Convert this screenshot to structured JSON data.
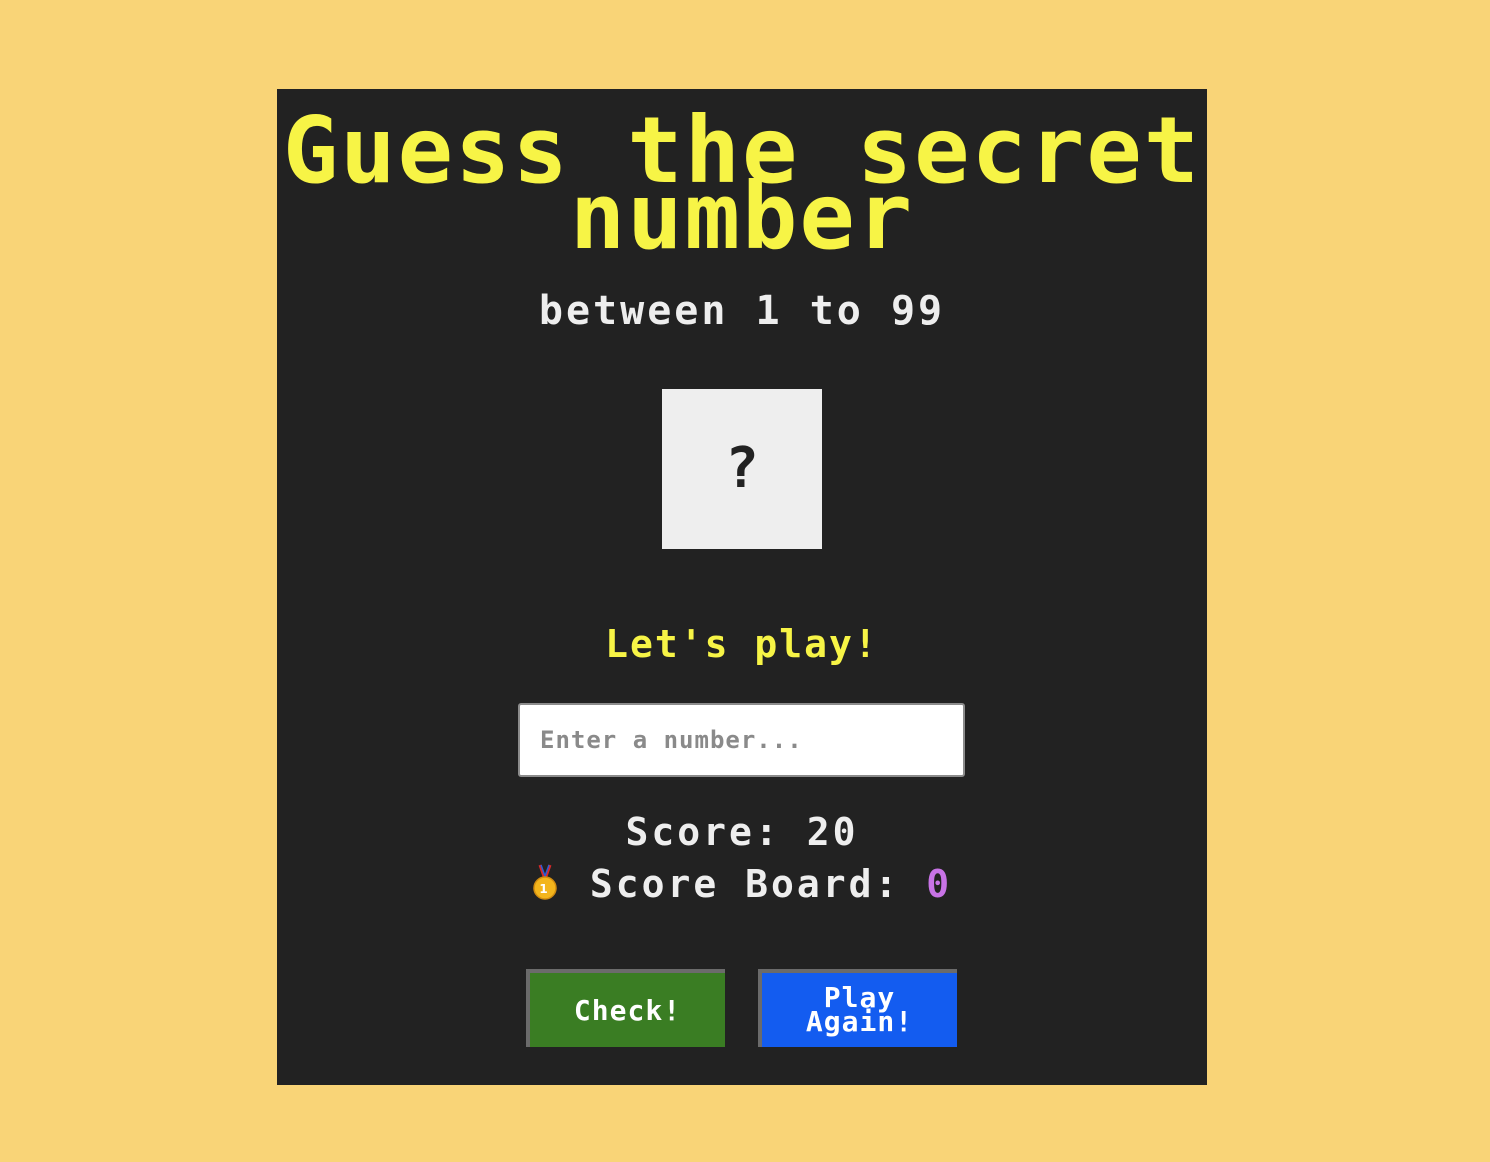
{
  "header": {
    "title": "Guess the secret number",
    "subtitle": "between 1 to 99"
  },
  "secret": {
    "display": "?"
  },
  "message": "Let's play!",
  "guess_input": {
    "placeholder": "Enter a number...",
    "value": ""
  },
  "score": {
    "label": "Score: 20"
  },
  "scoreboard": {
    "icon": "first-place-medal-icon",
    "label": "Score Board:",
    "value": "0"
  },
  "buttons": {
    "check": "Check!",
    "play_again": "Play Again!"
  },
  "colors": {
    "background": "#f9d477",
    "card": "#222222",
    "accent_yellow": "#f7f446",
    "check_button": "#3a7d23",
    "play_again_button": "#135cf0",
    "scoreboard_value": "#c873e6"
  }
}
